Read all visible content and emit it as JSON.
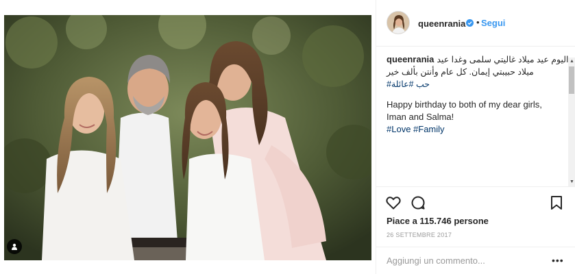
{
  "post": {
    "image_alt": "Family portrait photo",
    "user_tag_icon": "user-icon"
  },
  "header": {
    "username": "queenrania",
    "verified_icon": "verified-badge-icon",
    "separator": "•",
    "follow_label": "Segui"
  },
  "caption": {
    "username": "queenrania",
    "arabic_line1": "اليوم عيد ميلاد غاليتي سلمى وغدا عيد",
    "arabic_line2": "ميلاد حبيبتي إيمان. كل عام وأنتن بألف خير",
    "arabic_hashtags": "حب #عائلة#",
    "english_line1": "Happy birthday to both of my dear girls,",
    "english_line2": "Iman and Salma!",
    "english_hashtags": "#Love #Family"
  },
  "actions": {
    "like_icon": "heart-icon",
    "comment_icon": "comment-icon",
    "save_icon": "bookmark-icon",
    "likes_text": "Piace a 115.746 persone",
    "date": "26 SETTEMBRE 2017"
  },
  "comment_box": {
    "placeholder": "Aggiungi un commento...",
    "more": "•••"
  },
  "colors": {
    "link": "#3897f0",
    "hashtag": "#003569",
    "text": "#262626",
    "muted": "#999999"
  }
}
